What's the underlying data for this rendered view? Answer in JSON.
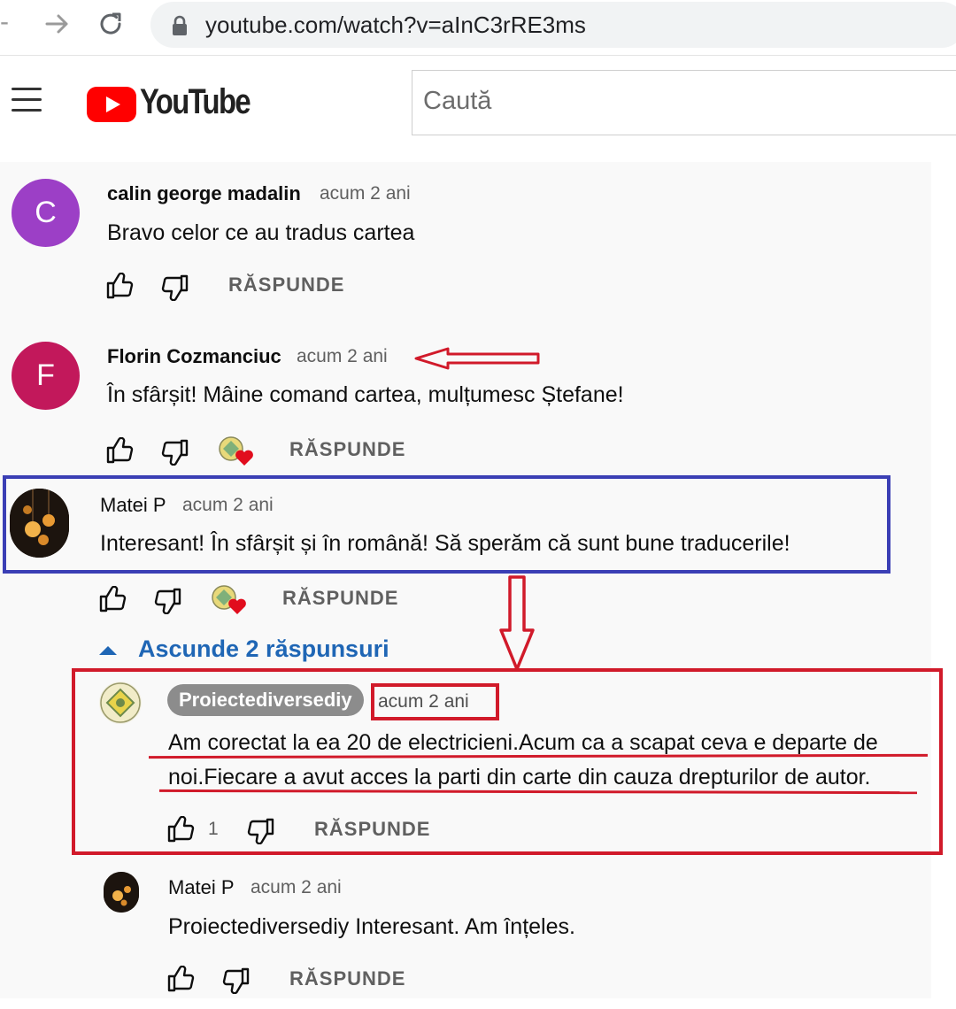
{
  "browser": {
    "back_icon": "back-arrow-icon",
    "forward_icon": "forward-arrow-icon",
    "reload_icon": "reload-icon",
    "lock_icon": "lock-icon",
    "url": "youtube.com/watch?v=aInC3rRE3ms"
  },
  "header": {
    "menu_icon": "hamburger-menu-icon",
    "logo_text": "YouTube",
    "logo_color": "#ff0000",
    "search_placeholder": "Caută"
  },
  "comments": [
    {
      "author": "calin george madalin",
      "time": "acum 2 ani",
      "avatar_letter": "C",
      "avatar_color": "#9c3fc6",
      "text": "Bravo celor ce au tradus cartea",
      "reply_label": "RĂSPUNDE"
    },
    {
      "author": "Florin Cozmanciuc",
      "time": "acum 2 ani",
      "avatar_letter": "F",
      "avatar_color": "#c2185b",
      "text": "În sfârșit! Mâine comand cartea, mulțumesc Ștefane!",
      "reply_label": "RĂSPUNDE",
      "creator_heart": true
    },
    {
      "author": "Matei P",
      "time": "acum 2 ani",
      "avatar": "lightbulbs-photo",
      "text": "Interesant! În sfârșit și în română! Să sperăm că sunt bune traducerile!",
      "reply_label": "RĂSPUNDE",
      "creator_heart": true,
      "hide_replies_label": "Ascunde 2 răspunsuri",
      "replies": [
        {
          "author": "Proiectediversediy",
          "time": "acum 2 ani",
          "is_channel_owner": true,
          "text_line1": "Am corectat la ea 20 de electricieni.Acum ca a scapat ceva e departe de",
          "text_line2": "noi.Fiecare a avut acces la parti din carte din cauza drepturilor de autor.",
          "like_count": "1",
          "reply_label": "RĂSPUNDE"
        },
        {
          "author": "Matei P",
          "time": "acum 2 ani",
          "text": "Proiectediversediy Interesant. Am înțeles.",
          "reply_label": "RĂSPUNDE"
        }
      ]
    }
  ],
  "annotation_colors": {
    "red": "#d11a2a",
    "blue": "#3b3fb5"
  }
}
